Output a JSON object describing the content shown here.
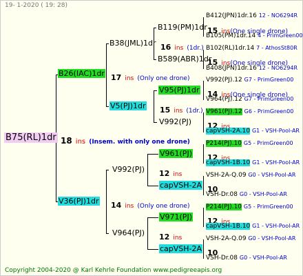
{
  "header": "19-  1-2020  ( 19: 28)",
  "footer": "Copyright 2004-2020 @ Karl Kehrle Foundation    www.pedigreeapis.org",
  "root": {
    "name": "B75(RL)1dr",
    "ins_num": "18",
    "ins_label": "ins",
    "note": "(Insem. with only one drone)"
  },
  "upper": {
    "name": "B26(IAC)1dr",
    "ins_num": "17",
    "ins_label": "ins",
    "note": "(Only one drone)",
    "a": {
      "name": "B38(JML)1dr",
      "ins_num": "16",
      "ins_label": "ins",
      "note": "(1dr.)",
      "a": {
        "name": "B119(PM)1dr"
      },
      "b": {
        "name": "B589(ABR)1dr"
      }
    },
    "b": {
      "name": "V5(PJ)1dr",
      "ins_num": "15",
      "ins_label": "ins",
      "note": "(1dr.)",
      "a": {
        "name": "V95(PJ)1dr"
      },
      "b": {
        "name": "V992(PJ)"
      }
    }
  },
  "lower": {
    "name": "V36(PJ)1dr",
    "ins_num": "14",
    "ins_label": "ins",
    "note": "(Only one drone)",
    "a": {
      "name": "V992(PJ)",
      "ins_num": "12",
      "ins_label": "ins",
      "a": {
        "name": "V961(PJ)"
      },
      "b": {
        "name": "capVSH-2A"
      }
    },
    "b": {
      "name": "V964(PJ)",
      "ins_num": "12",
      "ins_label": "ins",
      "a": {
        "name": "V971(PJ)"
      },
      "b": {
        "name": "capVSH-2A"
      }
    }
  },
  "right": [
    {
      "id": "r1",
      "name": "B412(JPN)1dr.16",
      "tail": "12 - NO6294R"
    },
    {
      "id": "r2",
      "num": "15",
      "label": "ins",
      "note": "(One single drone)"
    },
    {
      "id": "r3",
      "name": "B105(PM)1dr.14",
      "tail": "4 - PrimGreen00"
    },
    {
      "id": "r4",
      "name": "B102(RL)1dr.14",
      "tail": "7 - AthosSt80R"
    },
    {
      "id": "r5",
      "num": "15",
      "label": "ins",
      "note": "(One single drone)"
    },
    {
      "id": "r6",
      "name": "B408(JPN)1dr.16",
      "tail": "12 - NO6294R"
    },
    {
      "id": "r7",
      "name": "V992(PJ).12",
      "tail": "G7 - PrimGreen00"
    },
    {
      "id": "r8",
      "num": "14",
      "label": "ins",
      "note": "(One single drone)"
    },
    {
      "id": "r9",
      "name": "V964(PJ).12",
      "tail": "G7 - PrimGreen00"
    },
    {
      "id": "r10",
      "name": "V961(PJ).12",
      "tail": "G6 - PrimGreen00"
    },
    {
      "id": "r11",
      "num": "12",
      "label": "ins"
    },
    {
      "id": "r12",
      "name": "capVSH-2A.10",
      "tail": "G1 - VSH-Pool-AR"
    },
    {
      "id": "r13",
      "name": "P214(PJ).10",
      "tail": "G5 - PrimGreen00"
    },
    {
      "id": "r14",
      "num": "12",
      "label": "ins"
    },
    {
      "id": "r15",
      "name": "capVSH-1B.10",
      "tail": "G1 - VSH-Pool-AR"
    },
    {
      "id": "r16",
      "name": "VSH-2A-Q.09",
      "tail": "G0 - VSH-Pool-AR"
    },
    {
      "id": "r17",
      "num": "10"
    },
    {
      "id": "r18",
      "name": "VSH-Dr.08",
      "tail": "G0 - VSH-Pool-AR"
    },
    {
      "id": "r19",
      "name": "P214(PJ).10",
      "tail": "G5 - PrimGreen00"
    },
    {
      "id": "r20",
      "num": "12",
      "label": "ins"
    },
    {
      "id": "r21",
      "name": "capVSH-1B.10",
      "tail": "G1 - VSH-Pool-AR"
    },
    {
      "id": "r22",
      "name": "VSH-2A-Q.09",
      "tail": "G0 - VSH-Pool-AR"
    },
    {
      "id": "r23",
      "num": "10"
    },
    {
      "id": "r24",
      "name": "VSH-Dr.08",
      "tail": "G0 - VSH-Pool-AR"
    }
  ]
}
